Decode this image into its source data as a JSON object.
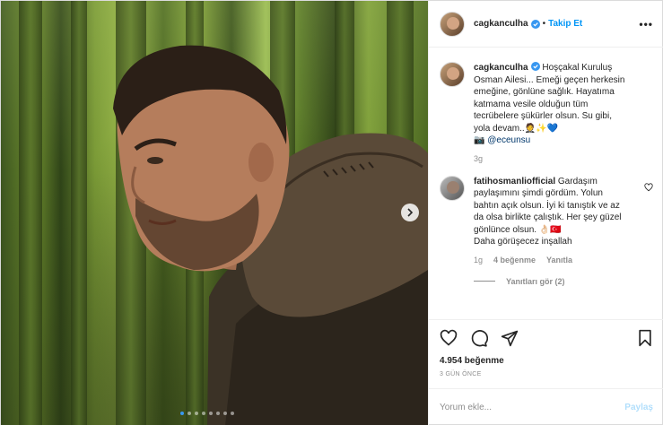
{
  "post": {
    "author": "cagkanculha",
    "follow_label": "Takip Et",
    "more_label": "•••",
    "caption": "Hoşçakal Kuruluş Osman Ailesi... Emeği geçen herkesin emeğine, gönlüne sağlık. Hayatıma katmama vesile olduğun tüm tecrübelere şükürler olsun. Su gibi, yola devam..",
    "caption_emoji": "🤵✨💙",
    "credit_icon": "📷",
    "credit": "@eceunsu",
    "caption_age": "3g",
    "likes": "4.954 beğenme",
    "posted": "3 GÜN ÖNCE"
  },
  "comment": {
    "author": "fatihosmanliofficial",
    "text": "Gardaşım paylaşımını şimdi gördüm. Yolun bahtın açık olsun. İyi ki tanıştık ve az da olsa birlikte çalıştık. Her şey güzel gönlünce olsun.",
    "emoji": "👌🏻🇹🇷",
    "text2": "Daha görüşecez inşallah",
    "age": "1g",
    "likes": "4 beğenme",
    "reply_label": "Yanıtla",
    "view_replies": "Yanıtları gör (2)"
  },
  "add_comment": {
    "placeholder": "Yorum ekle...",
    "post_label": "Paylaş"
  },
  "carousel": {
    "count": 8,
    "active_index": 0
  },
  "colors": {
    "link": "#0095f6",
    "muted": "#8e8e8e",
    "active_dot": "#3897f0"
  },
  "icons": [
    "verified-badge-icon",
    "heart-icon",
    "comment-icon",
    "share-icon",
    "bookmark-icon",
    "chevron-right-icon",
    "camera-icon"
  ]
}
